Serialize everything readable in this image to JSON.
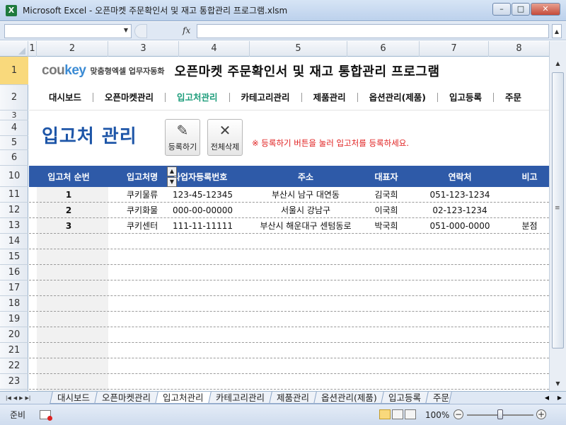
{
  "window": {
    "title": "Microsoft Excel - 오픈마켓 주문확인서 및 재고 통합관리 프로그램.xlsm",
    "controls": [
      "–",
      "□",
      "✕"
    ]
  },
  "formula_bar": {
    "name_box": "",
    "fx": "fx",
    "content": ""
  },
  "columns": [
    "1",
    "2",
    "3",
    "4",
    "5",
    "6",
    "7",
    "8"
  ],
  "rows": [
    "1",
    "2",
    "3",
    "4",
    "5",
    "6",
    "10",
    "11",
    "12",
    "13",
    "14",
    "15",
    "16",
    "17",
    "18",
    "19",
    "20",
    "21",
    "22",
    "23"
  ],
  "active_row": "1",
  "header": {
    "logo_cou": "cou",
    "logo_key": "key",
    "logo_sub": "맞춤형엑셀 업무자동화",
    "title": "오픈마켓 주문확인서 및 재고 통합관리 프로그램"
  },
  "nav": {
    "items": [
      "대시보드",
      "오픈마켓관리",
      "입고처관리",
      "카테고리관리",
      "제품관리",
      "옵션관리(제품)",
      "입고등록",
      "주문"
    ],
    "active_index": 2
  },
  "page": {
    "title": "입고처 관리",
    "register_button": "등록하기",
    "delete_all_button": "전체삭제",
    "hint": "※ 등록하기 버튼을 눌러 입고처를 등록하세요."
  },
  "table": {
    "headers": [
      "입고처 순번",
      "입고처명",
      "사업자등록번호",
      "주소",
      "대표자",
      "연락처",
      "비고"
    ],
    "rows": [
      [
        "1",
        "쿠키물류",
        "123-45-12345",
        "부산시 남구 대연동",
        "김국희",
        "051-123-1234",
        ""
      ],
      [
        "2",
        "쿠키화물",
        "000-00-00000",
        "서울시 강남구",
        "이국희",
        "02-123-1234",
        ""
      ],
      [
        "3",
        "쿠키센터",
        "111-11-11111",
        "부산시 해운대구 센텀동로",
        "박국희",
        "051-000-0000",
        "분점"
      ]
    ]
  },
  "sheet_tabs": {
    "items": [
      "대시보드",
      "오픈마켓관리",
      "입고처관리",
      "카테고리관리",
      "제품관리",
      "옵션관리(제품)",
      "입고등록",
      "주문"
    ],
    "active_index": 2
  },
  "status": {
    "ready": "준비",
    "zoom": "100%",
    "zoom_fraction": 0.5
  }
}
